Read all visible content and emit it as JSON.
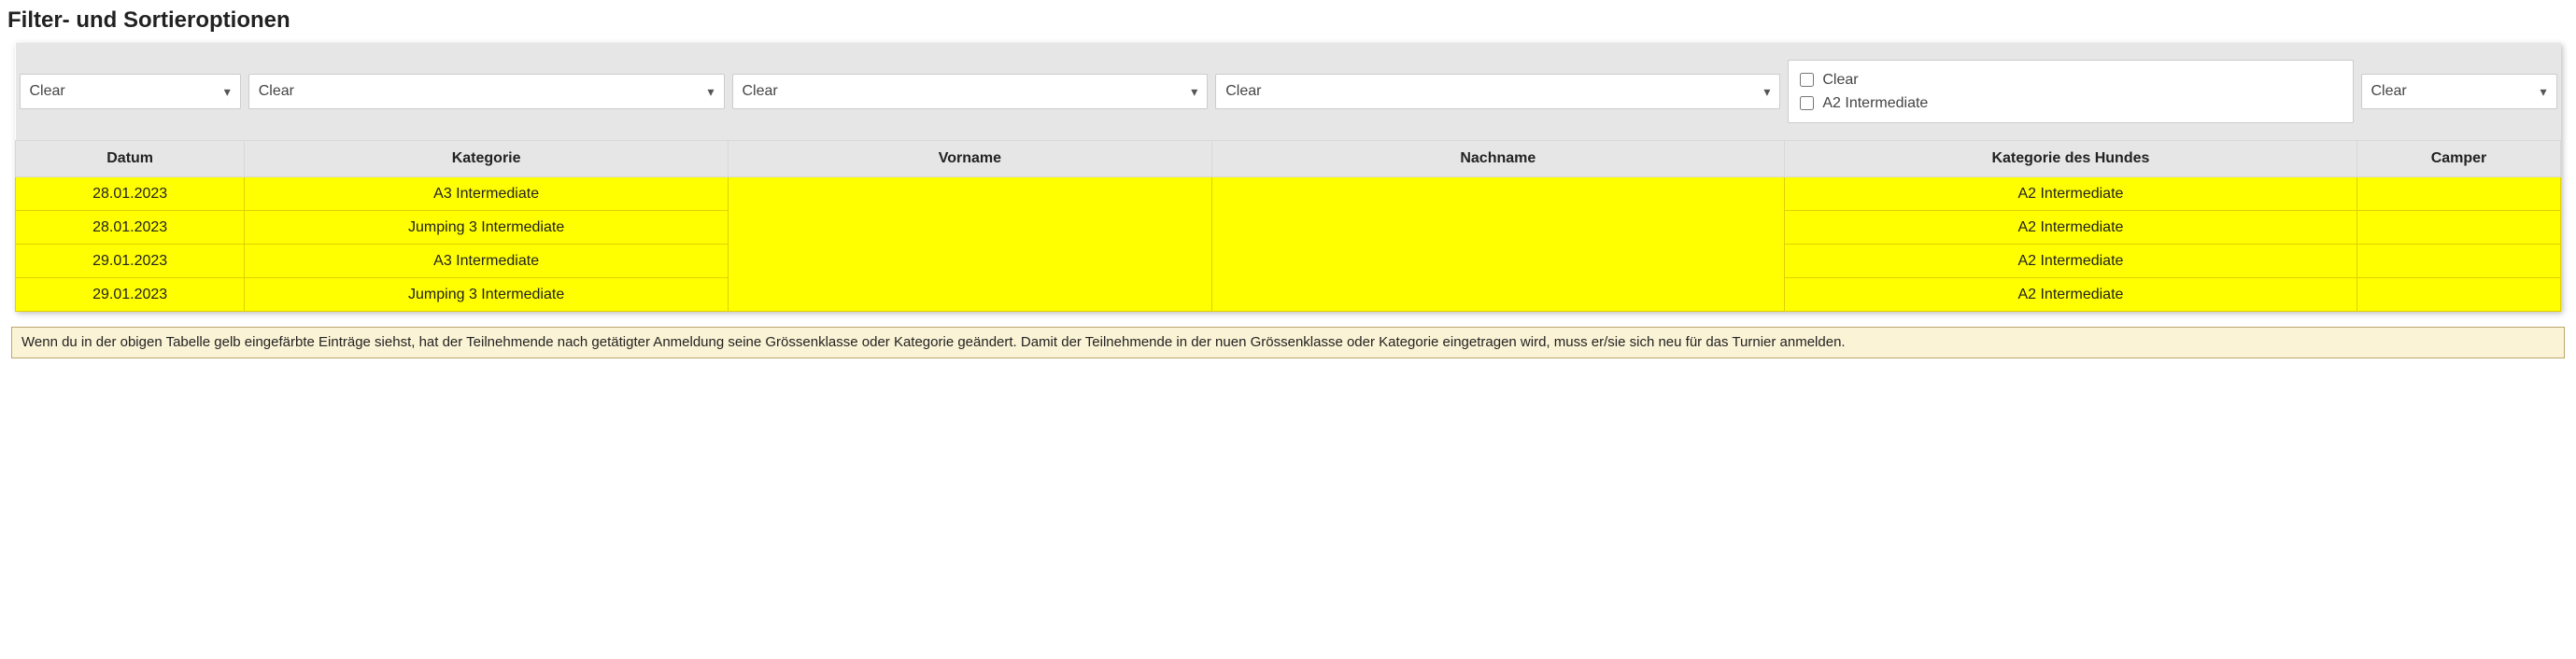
{
  "title": "Filter- und Sortieroptionen",
  "filters": {
    "datum": {
      "label": "Clear"
    },
    "kategorie": {
      "label": "Clear"
    },
    "vorname": {
      "label": "Clear"
    },
    "nachname": {
      "label": "Clear"
    },
    "hundkat": {
      "options": [
        {
          "label": "Clear",
          "checked": false
        },
        {
          "label": "A2 Intermediate",
          "checked": false
        }
      ]
    },
    "camper": {
      "label": "Clear"
    }
  },
  "headers": {
    "datum": "Datum",
    "kategorie": "Kategorie",
    "vorname": "Vorname",
    "nachname": "Nachname",
    "hundkat": "Kategorie des Hundes",
    "camper": "Camper"
  },
  "rows": [
    {
      "datum": "28.01.2023",
      "kategorie": "A3 Intermediate",
      "vorname": "",
      "nachname": "",
      "hundkat": "A2 Intermediate",
      "camper": ""
    },
    {
      "datum": "28.01.2023",
      "kategorie": "Jumping 3 Intermediate",
      "vorname": "",
      "nachname": "",
      "hundkat": "A2 Intermediate",
      "camper": ""
    },
    {
      "datum": "29.01.2023",
      "kategorie": "A3 Intermediate",
      "vorname": "",
      "nachname": "",
      "hundkat": "A2 Intermediate",
      "camper": ""
    },
    {
      "datum": "29.01.2023",
      "kategorie": "Jumping 3 Intermediate",
      "vorname": "",
      "nachname": "",
      "hundkat": "A2 Intermediate",
      "camper": ""
    }
  ],
  "note": "Wenn du in der obigen Tabelle gelb eingefärbte Einträge siehst, hat der Teilnehmende nach getätigter Anmeldung seine Grössenklasse oder Kategorie geändert. Damit der Teilnehmende in der nuen Grössenklasse oder Kategorie eingetragen wird, muss er/sie sich neu für das Turnier anmelden."
}
